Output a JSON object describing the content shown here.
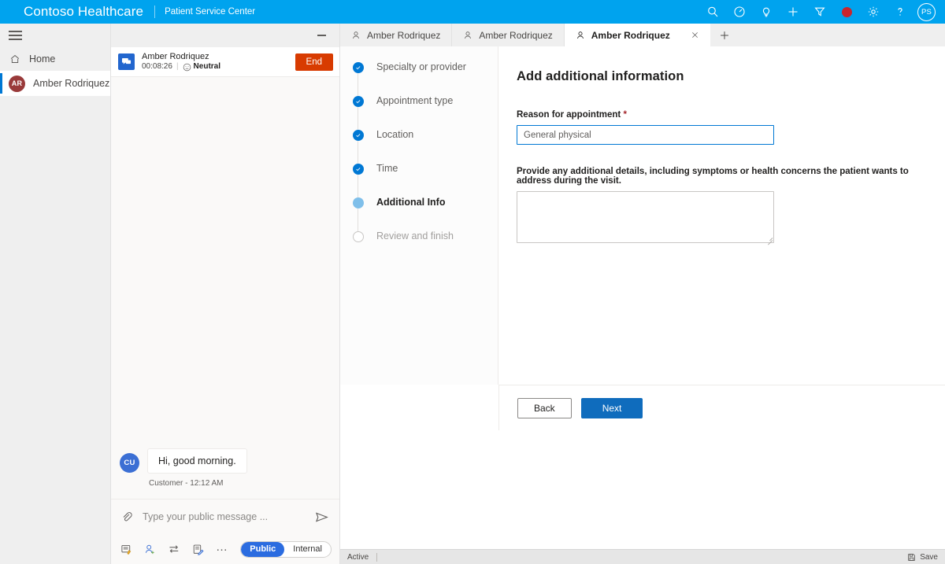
{
  "brand": {
    "title": "Contoso Healthcare",
    "subtitle": "Patient Service Center",
    "avatar_initials": "PS",
    "accent_color": "#00A3EE",
    "record_color": "#C9252D",
    "icons": [
      "search-icon",
      "gauge-icon",
      "lightbulb-icon",
      "plus-icon",
      "filter-icon",
      "record-icon",
      "gear-icon",
      "help-icon"
    ]
  },
  "rail": {
    "menu_icon": "hamburger-icon",
    "items": [
      {
        "label": "Home",
        "icon": "home-icon",
        "selected": false
      },
      {
        "label": "Amber Rodriquez",
        "icon": "avatar",
        "initials": "AR",
        "selected": true
      }
    ]
  },
  "chat": {
    "minimize_label": "Minimize",
    "customer_name": "Amber Rodriquez",
    "timer": "00:08:26",
    "sentiment": "Neutral",
    "end_label": "End",
    "messages": [
      {
        "initials": "CU",
        "text": "Hi, good morning.",
        "meta": "Customer - 12:12 AM"
      }
    ],
    "composer": {
      "placeholder": "Type your public message ...",
      "value": "",
      "attach_icon": "paperclip-icon",
      "send_icon": "send-icon",
      "tools": [
        "quick-reply-icon",
        "add-agent-icon",
        "transfer-icon",
        "notes-icon",
        "more-icon"
      ],
      "visibility_public": "Public",
      "visibility_internal": "Internal",
      "visibility_selected": "Public"
    }
  },
  "tabs": {
    "items": [
      {
        "label": "Amber Rodriquez",
        "active": false
      },
      {
        "label": "Amber Rodriquez",
        "active": false
      },
      {
        "label": "Amber Rodriquez",
        "active": true
      }
    ],
    "close_icon": "close-icon",
    "add_icon": "plus-icon"
  },
  "wizard": {
    "steps": [
      {
        "label": "Specialty or provider",
        "state": "complete"
      },
      {
        "label": "Appointment type",
        "state": "complete"
      },
      {
        "label": "Location",
        "state": "complete"
      },
      {
        "label": "Time",
        "state": "complete"
      },
      {
        "label": "Additional Info",
        "state": "current"
      },
      {
        "label": "Review and finish",
        "state": "pending"
      }
    ],
    "title": "Add additional information",
    "reason_label": "Reason for appointment",
    "reason_required": "*",
    "reason_placeholder": "General physical",
    "reason_value": "",
    "details_label": "Provide any additional details, including symptoms or health concerns the patient wants to address during the visit.",
    "details_placeholder": "",
    "details_value": "",
    "back_label": "Back",
    "next_label": "Next"
  },
  "status": {
    "state": "Active",
    "save_label": "Save",
    "save_icon": "save-icon"
  }
}
